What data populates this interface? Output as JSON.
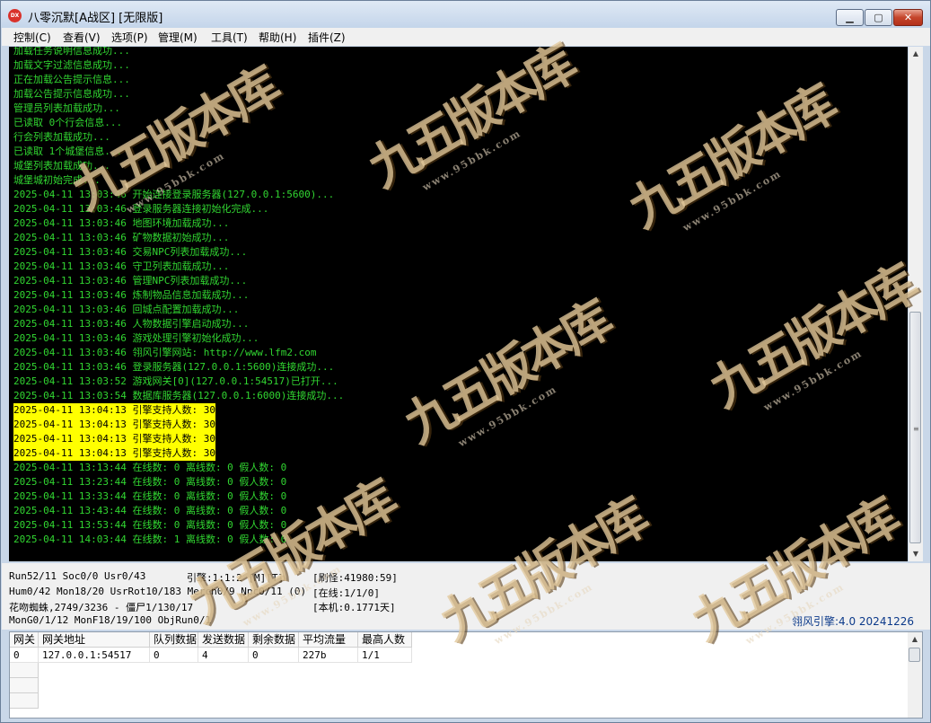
{
  "window": {
    "title": "八零沉默[A战区] [无限版]",
    "app_icon_text": "DX",
    "minimize": "▁",
    "maximize": "▢",
    "close": "✕"
  },
  "menu": [
    "控制(C)",
    "查看(V)",
    "选项(P)",
    "管理(M)",
    "工具(T)",
    "帮助(H)",
    "插件(Z)"
  ],
  "log": [
    {
      "text": "加载任务说明信息成功...",
      "hl": false
    },
    {
      "text": "加载文字过滤信息成功...",
      "hl": false
    },
    {
      "text": "正在加载公告提示信息...",
      "hl": false
    },
    {
      "text": "加载公告提示信息成功...",
      "hl": false
    },
    {
      "text": "管理员列表加载成功...",
      "hl": false
    },
    {
      "text": "已读取 0个行会信息...",
      "hl": false
    },
    {
      "text": "行会列表加载成功...",
      "hl": false
    },
    {
      "text": "已读取 1个城堡信息...",
      "hl": false
    },
    {
      "text": "城堡列表加载成功...",
      "hl": false
    },
    {
      "text": "城堡城初始完成...",
      "hl": false
    },
    {
      "text": "2025-04-11 13:03:46 开始连接登录服务器(127.0.0.1:5600)...",
      "hl": false
    },
    {
      "text": "2025-04-11 13:03:46 登录服务器连接初始化完成...",
      "hl": false
    },
    {
      "text": "2025-04-11 13:03:46 地图环境加载成功...",
      "hl": false
    },
    {
      "text": "2025-04-11 13:03:46 矿物数据初始成功...",
      "hl": false
    },
    {
      "text": "2025-04-11 13:03:46 交易NPC列表加载成功...",
      "hl": false
    },
    {
      "text": "2025-04-11 13:03:46 守卫列表加载成功...",
      "hl": false
    },
    {
      "text": "2025-04-11 13:03:46 管理NPC列表加载成功...",
      "hl": false
    },
    {
      "text": "2025-04-11 13:03:46 炼制物品信息加载成功...",
      "hl": false
    },
    {
      "text": "2025-04-11 13:03:46 回城点配置加载成功...",
      "hl": false
    },
    {
      "text": "2025-04-11 13:03:46 人物数据引擎启动成功...",
      "hl": false
    },
    {
      "text": "2025-04-11 13:03:46 游戏处理引擎初始化成功...",
      "hl": false
    },
    {
      "text": "2025-04-11 13:03:46 翎风引擎网站: http://www.lfm2.com",
      "hl": false
    },
    {
      "text": "2025-04-11 13:03:46 登录服务器(127.0.0.1:5600)连接成功...",
      "hl": false
    },
    {
      "text": "2025-04-11 13:03:52 游戏网关[0](127.0.0.1:54517)已打开...",
      "hl": false
    },
    {
      "text": "2025-04-11 13:03:54 数据库服务器(127.0.0.1:6000)连接成功...",
      "hl": false
    },
    {
      "text": "2025-04-11 13:04:13 引擎支持人数: 30",
      "hl": true
    },
    {
      "text": "2025-04-11 13:04:13 引擎支持人数: 30",
      "hl": true
    },
    {
      "text": "2025-04-11 13:04:13 引擎支持人数: 30",
      "hl": true
    },
    {
      "text": "2025-04-11 13:04:13 引擎支持人数: 30",
      "hl": true
    },
    {
      "text": "2025-04-11 13:13:44 在线数: 0 离线数: 0 假人数: 0",
      "hl": false
    },
    {
      "text": "2025-04-11 13:23:44 在线数: 0 离线数: 0 假人数: 0",
      "hl": false
    },
    {
      "text": "2025-04-11 13:33:44 在线数: 0 离线数: 0 假人数: 0",
      "hl": false
    },
    {
      "text": "2025-04-11 13:43:44 在线数: 0 离线数: 0 假人数: 0",
      "hl": false
    },
    {
      "text": "2025-04-11 13:53:44 在线数: 0 离线数: 0 假人数: 0",
      "hl": false
    },
    {
      "text": "2025-04-11 14:03:44 在线数: 1 离线数: 0 假人数: 0",
      "hl": false
    }
  ],
  "status": {
    "run": "Run52/11 Soc0/0 Usr0/43",
    "engine": "引擎:1:1:2 [M][T]",
    "refresh": "[刷怪:41980:59]",
    "hum": "Hum0/42 Mon18/20 UsrRot10/183 Merch0/9 Npc0/11 (0)",
    "online": "[在线:1/1/0]",
    "map": "花吻蜘蛛,2749/3236 - 僵尸1/130/17",
    "local": "[本机:0.1771天]",
    "mon": "MonG0/1/12 MonF18/19/100 ObjRun0/1",
    "version": "翎风引擎:4.0 20241226"
  },
  "gateway_table": {
    "columns": [
      "网关",
      "网关地址",
      "队列数据",
      "发送数据",
      "剩余数据",
      "平均流量",
      "最高人数"
    ],
    "rows": [
      [
        "0",
        "127.0.0.1:54517",
        "0",
        "4",
        "0",
        "227b",
        "1/1"
      ]
    ]
  },
  "watermark": {
    "text": "九五版本库",
    "url": "www.95bbk.com"
  }
}
